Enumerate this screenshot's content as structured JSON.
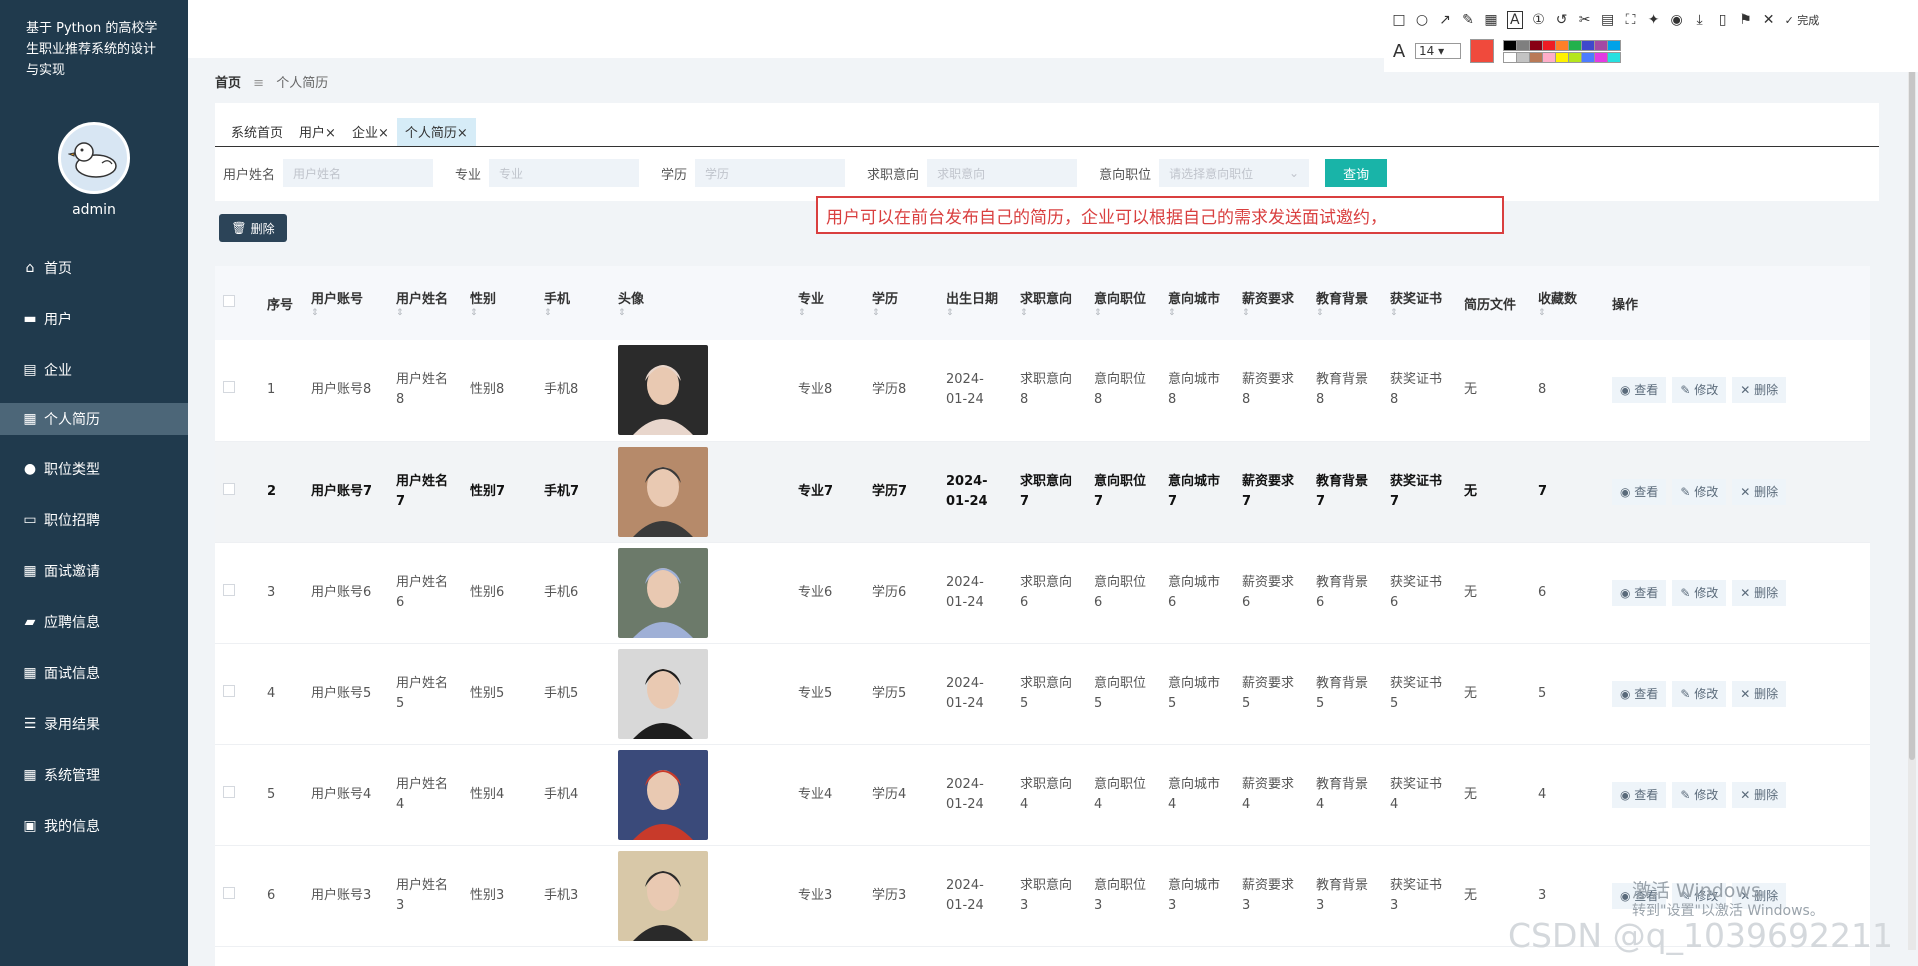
{
  "sidebar": {
    "title": "基于 Python 的高校学生职业推荐系统的设计与实现",
    "username": "admin",
    "items": [
      {
        "label": "首页",
        "icon": "home-icon"
      },
      {
        "label": "用户",
        "icon": "briefcase-icon"
      },
      {
        "label": "企业",
        "icon": "clipboard-icon"
      },
      {
        "label": "个人简历",
        "icon": "grid-icon"
      },
      {
        "label": "职位类型",
        "icon": "user-icon"
      },
      {
        "label": "职位招聘",
        "icon": "monitor-icon"
      },
      {
        "label": "面试邀请",
        "icon": "grid-icon"
      },
      {
        "label": "应聘信息",
        "icon": "id-card-icon"
      },
      {
        "label": "面试信息",
        "icon": "grid-icon"
      },
      {
        "label": "录用结果",
        "icon": "list-icon"
      },
      {
        "label": "系统管理",
        "icon": "apps-icon"
      },
      {
        "label": "我的信息",
        "icon": "window-icon"
      }
    ]
  },
  "toolbar": {
    "finish_label": "完成",
    "font_size": "14",
    "selected_color": "#f04a3c",
    "colors": [
      "#000000",
      "#7f7f7f",
      "#880015",
      "#ed1c24",
      "#ff7f27",
      "#22b14c",
      "#3f48cc",
      "#a349a4",
      "#00a2e8",
      "#ffffff",
      "#c3c3c3",
      "#b97a57",
      "#ffaec9",
      "#fff200",
      "#b5e61d",
      "#4d7cff",
      "#e33be3",
      "#26e0e0"
    ]
  },
  "breadcrumb": {
    "home": "首页",
    "current": "个人简历"
  },
  "tabs": [
    {
      "label": "系统首页",
      "closable": false
    },
    {
      "label": "用户",
      "closable": true
    },
    {
      "label": "企业",
      "closable": true
    },
    {
      "label": "个人简历",
      "closable": true
    }
  ],
  "filters": {
    "f1_label": "用户姓名",
    "f1_placeholder": "用户姓名",
    "f2_label": "专业",
    "f2_placeholder": "专业",
    "f3_label": "学历",
    "f3_placeholder": "学历",
    "f4_label": "求职意向",
    "f4_placeholder": "求职意向",
    "f5_label": "意向职位",
    "f5_placeholder": "请选择意向职位",
    "query_label": "查询"
  },
  "annotation": "用户可以在前台发布自己的简历，企业可以根据自己的需求发送面试邀约，",
  "delete_button": "删除",
  "table": {
    "headers": [
      "序号",
      "用户账号",
      "用户姓名",
      "性别",
      "手机",
      "头像",
      "专业",
      "学历",
      "出生日期",
      "求职意向",
      "意向职位",
      "意向城市",
      "薪资要求",
      "教育背景",
      "获奖证书",
      "简历文件",
      "收藏数",
      "操作"
    ],
    "rows": [
      {
        "no": "1",
        "account": "用户账号8",
        "name": "用户姓名8",
        "gender": "性别8",
        "phone": "手机8",
        "major": "专业8",
        "edu": "学历8",
        "birth": "2024-01-24",
        "intent": "求职意向8",
        "position": "意向职位8",
        "city": "意向城市8",
        "salary": "薪资要求8",
        "background": "教育背景8",
        "cert": "获奖证书8",
        "file": "无",
        "fav": "8"
      },
      {
        "no": "2",
        "account": "用户账号7",
        "name": "用户姓名7",
        "gender": "性别7",
        "phone": "手机7",
        "major": "专业7",
        "edu": "学历7",
        "birth": "2024-01-24",
        "intent": "求职意向7",
        "position": "意向职位7",
        "city": "意向城市7",
        "salary": "薪资要求7",
        "background": "教育背景7",
        "cert": "获奖证书7",
        "file": "无",
        "fav": "7"
      },
      {
        "no": "3",
        "account": "用户账号6",
        "name": "用户姓名6",
        "gender": "性别6",
        "phone": "手机6",
        "major": "专业6",
        "edu": "学历6",
        "birth": "2024-01-24",
        "intent": "求职意向6",
        "position": "意向职位6",
        "city": "意向城市6",
        "salary": "薪资要求6",
        "background": "教育背景6",
        "cert": "获奖证书6",
        "file": "无",
        "fav": "6"
      },
      {
        "no": "4",
        "account": "用户账号5",
        "name": "用户姓名5",
        "gender": "性别5",
        "phone": "手机5",
        "major": "专业5",
        "edu": "学历5",
        "birth": "2024-01-24",
        "intent": "求职意向5",
        "position": "意向职位5",
        "city": "意向城市5",
        "salary": "薪资要求5",
        "background": "教育背景5",
        "cert": "获奖证书5",
        "file": "无",
        "fav": "5"
      },
      {
        "no": "5",
        "account": "用户账号4",
        "name": "用户姓名4",
        "gender": "性别4",
        "phone": "手机4",
        "major": "专业4",
        "edu": "学历4",
        "birth": "2024-01-24",
        "intent": "求职意向4",
        "position": "意向职位4",
        "city": "意向城市4",
        "salary": "薪资要求4",
        "background": "教育背景4",
        "cert": "获奖证书4",
        "file": "无",
        "fav": "4"
      },
      {
        "no": "6",
        "account": "用户账号3",
        "name": "用户姓名3",
        "gender": "性别3",
        "phone": "手机3",
        "major": "专业3",
        "edu": "学历3",
        "birth": "2024-01-24",
        "intent": "求职意向3",
        "position": "意向职位3",
        "city": "意向城市3",
        "salary": "薪资要求3",
        "background": "教育背景3",
        "cert": "获奖证书3",
        "file": "无",
        "fav": "3"
      }
    ],
    "actions": {
      "view": "查看",
      "edit": "修改",
      "delete": "删除"
    }
  },
  "watermark": {
    "activate_title": "激活 Windows",
    "activate_sub": "转到\"设置\"以激活 Windows。",
    "csdn": "CSDN @q_1039692211"
  }
}
